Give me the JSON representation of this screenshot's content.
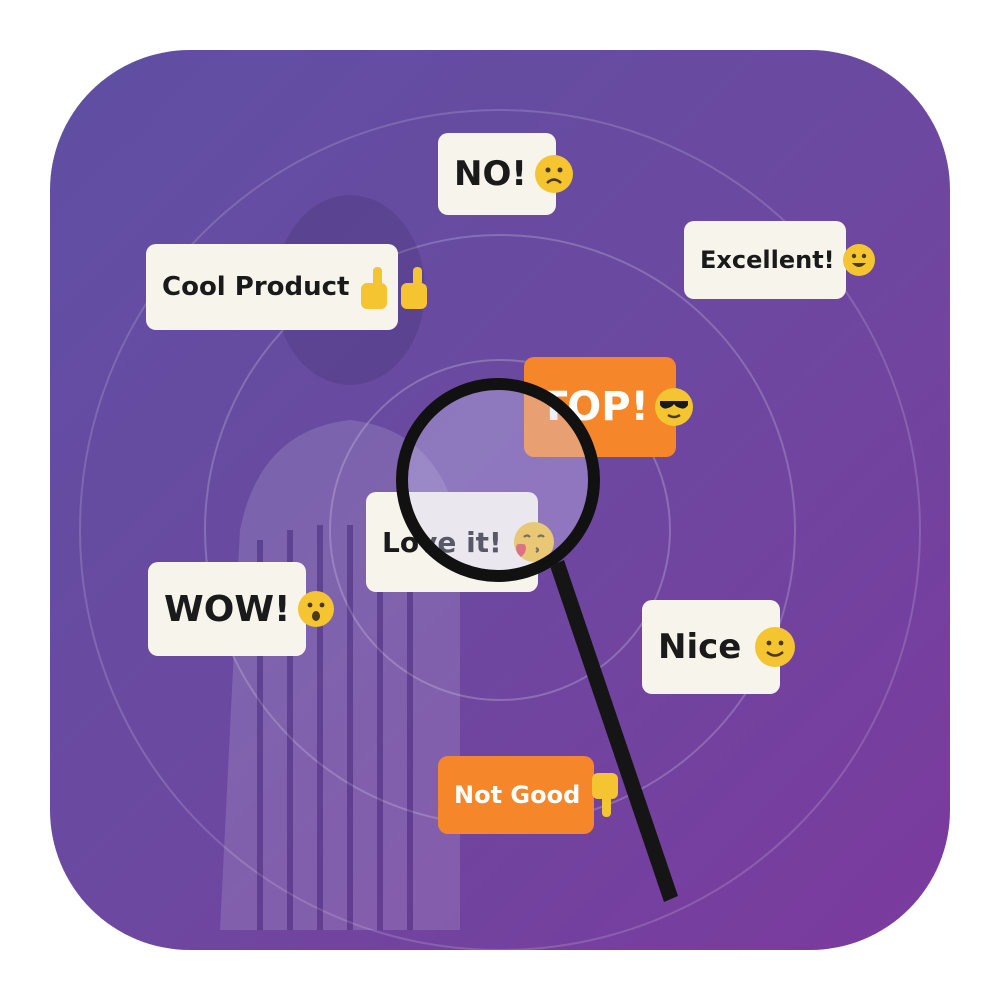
{
  "bubbles": {
    "no": {
      "text": "NO!",
      "emoji": "sad-face-icon"
    },
    "cool_product": {
      "text": "Cool Product",
      "emoji": "thumbs-up-icon"
    },
    "excellent": {
      "text": "Excellent!",
      "emoji": "grinning-face-icon"
    },
    "top": {
      "text": "TOP!",
      "emoji": "sunglasses-face-icon"
    },
    "love_it": {
      "text": "Love it!",
      "emoji": "kissing-face-icon"
    },
    "wow": {
      "text": "WOW!",
      "emoji": "surprised-face-icon"
    },
    "nice": {
      "text": "Nice",
      "emoji": "smiling-face-icon"
    },
    "not_good": {
      "text": "Not Good",
      "emoji": "thumbs-down-icon"
    }
  },
  "colors": {
    "background_start": "#5f4fa3",
    "background_end": "#7b3a9e",
    "bubble_light": "#f7f4ec",
    "bubble_orange": "#f5862a",
    "emoji_yellow": "#f4c431",
    "magnifier_frame": "#111111"
  },
  "magnifier": {
    "icon": "magnifying-glass-icon"
  }
}
